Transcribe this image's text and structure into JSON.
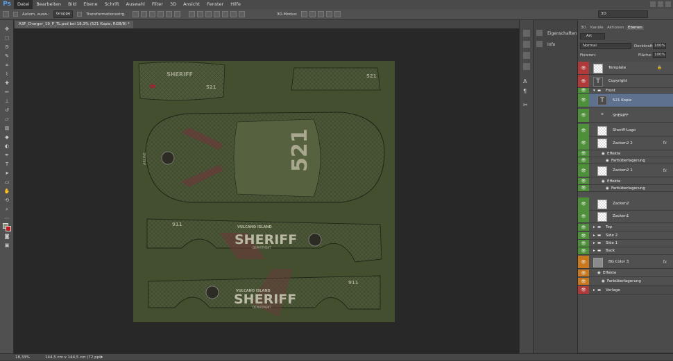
{
  "app": {
    "logo": "Ps"
  },
  "menu": [
    "Datei",
    "Bearbeiten",
    "Bild",
    "Ebene",
    "Schrift",
    "Auswahl",
    "Filter",
    "3D",
    "Ansicht",
    "Fenster",
    "Hilfe"
  ],
  "options": {
    "auto_select": "Autom. ausw.:",
    "group": "Gruppe",
    "transform": "Transformationsstrg.",
    "mode3d": "3D-Modus:",
    "workspace": "3D"
  },
  "document": {
    "tab_title": "A3F_Charger_19_P_TL.psd bei 18,3% (521 Kopie, RGB/8) *"
  },
  "status": {
    "zoom": "18,33%",
    "doc_size": "144,5 cm x 144,5 cm (72 ppi)"
  },
  "side_panels": {
    "properties": "Eigenschaften",
    "info": "Info"
  },
  "layers_panel": {
    "tabs": [
      "3D",
      "Kanäle",
      "Aktionen",
      "Ebenen"
    ],
    "filter_kind": "Art",
    "blend_mode": "Normal",
    "opacity_label": "Deckkraft:",
    "opacity": "100%",
    "lock_label": "Fixieren:",
    "fill_label": "Fläche:",
    "fill": "100%",
    "layers": [
      {
        "name": "Template",
        "color": "#b03a3a"
      },
      {
        "name": "Copyright",
        "color": "#b03a3a"
      },
      {
        "name": "Front",
        "color": "#4e8f3a"
      },
      {
        "name": "521 Kopie",
        "color": "#4e8f3a"
      },
      {
        "name": "SHERIFF",
        "color": "#4e8f3a"
      },
      {
        "name": "Sheriff-Logo",
        "color": "#4e8f3a"
      },
      {
        "name": "Zacken2 2",
        "color": "#4e8f3a"
      },
      {
        "name": "Effekte",
        "color": "#4e8f3a"
      },
      {
        "name": "Farbüberlagerung",
        "color": "#4e8f3a"
      },
      {
        "name": "Zacken2 1",
        "color": "#4e8f3a"
      },
      {
        "name": "Effekte",
        "color": "#4e8f3a"
      },
      {
        "name": "Farbüberlagerung",
        "color": "#4e8f3a"
      },
      {
        "name": "Zacken2",
        "color": "#4e8f3a"
      },
      {
        "name": "Zacken1",
        "color": "#4e8f3a"
      },
      {
        "name": "Top",
        "color": "#4e8f3a"
      },
      {
        "name": "Side 2",
        "color": "#4e8f3a"
      },
      {
        "name": "Side 1",
        "color": "#4e8f3a"
      },
      {
        "name": "Back",
        "color": "#4e8f3a"
      },
      {
        "name": "BG Color 3",
        "color": "#c9781e"
      },
      {
        "name": "Effekte",
        "color": "#c9781e"
      },
      {
        "name": "Farbüberlagerung",
        "color": "#c9781e"
      },
      {
        "name": "Vorlage",
        "color": "#b03a3a"
      }
    ]
  },
  "livery": {
    "unit_number": "521",
    "agency": "SHERIFF",
    "island": "VULCANO ISLAND",
    "dept": "DEPARTMENT",
    "phone": "911",
    "side_text": "ARLINE"
  }
}
